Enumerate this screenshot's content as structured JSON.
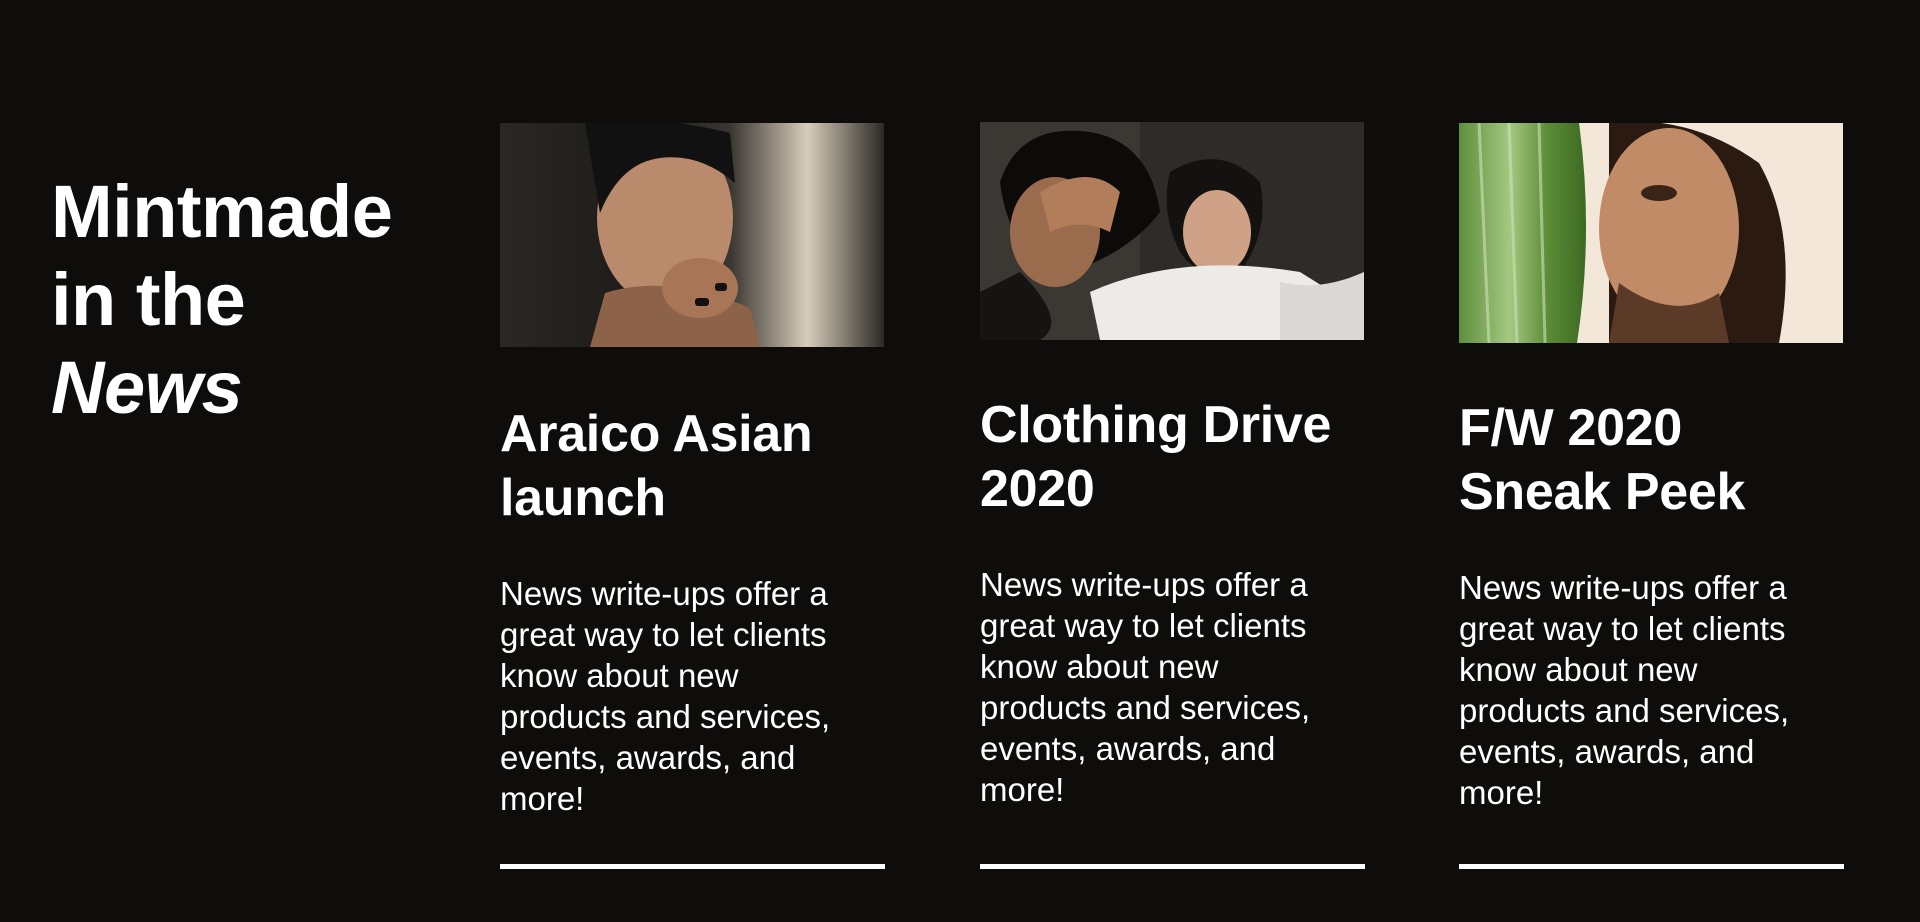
{
  "section": {
    "title_line1": "Mintmade",
    "title_line2": "in the",
    "title_line3": "News"
  },
  "colors": {
    "background": "#0e0d0c",
    "text": "#ffffff"
  },
  "cards": [
    {
      "title": "Araico Asian launch",
      "text": "News write-ups offer a great way to let clients know about new products and services, events, awards, and more!"
    },
    {
      "title": "Clothing Drive 2020",
      "text": "News write-ups offer a great way to let clients know about new products and services, events, awards, and more!"
    },
    {
      "title": "F/W 2020 Sneak Peek",
      "text": "News write-ups offer a great way to let clients know about new products and services, events, awards, and more!"
    }
  ]
}
